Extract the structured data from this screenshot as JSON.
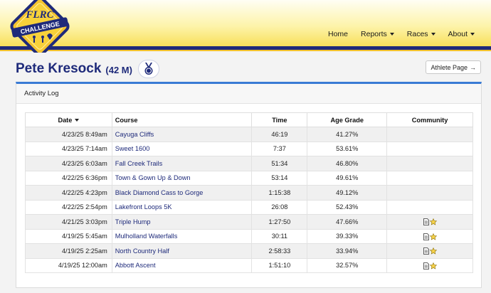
{
  "brand": {
    "logo_line1": "FLRC",
    "logo_line2": "CHALLENGE",
    "navy": "#1e2a7a",
    "yellow": "#f7dd52"
  },
  "nav": [
    {
      "label": "Home",
      "has_caret": false
    },
    {
      "label": "Reports",
      "has_caret": true
    },
    {
      "label": "Races",
      "has_caret": true
    },
    {
      "label": "About",
      "has_caret": true
    }
  ],
  "athlete": {
    "name": "Pete Kresock",
    "meta": "(42 M)",
    "page_button": "Athlete Page",
    "medal_icon": "medal-icon"
  },
  "card": {
    "title": "Activity Log"
  },
  "table": {
    "headers": {
      "date": "Date",
      "course": "Course",
      "time": "Time",
      "age_grade": "Age Grade",
      "community": "Community"
    },
    "rows": [
      {
        "date": "4/23/25 8:49am",
        "course": "Cayuga Cliffs",
        "time": "46:19",
        "age_grade": "41.27%",
        "community": false
      },
      {
        "date": "4/23/25 7:14am",
        "course": "Sweet 1600",
        "time": "7:37",
        "age_grade": "53.61%",
        "community": false
      },
      {
        "date": "4/23/25 6:03am",
        "course": "Fall Creek Trails",
        "time": "51:34",
        "age_grade": "46.80%",
        "community": false
      },
      {
        "date": "4/22/25 6:36pm",
        "course": "Town & Gown Up & Down",
        "time": "53:14",
        "age_grade": "49.61%",
        "community": false
      },
      {
        "date": "4/22/25 4:23pm",
        "course": "Black Diamond Cass to Gorge",
        "time": "1:15:38",
        "age_grade": "49.12%",
        "community": false
      },
      {
        "date": "4/22/25 2:54pm",
        "course": "Lakefront Loops 5K",
        "time": "26:08",
        "age_grade": "52.43%",
        "community": false
      },
      {
        "date": "4/21/25 3:03pm",
        "course": "Triple Hump",
        "time": "1:27:50",
        "age_grade": "47.66%",
        "community": true
      },
      {
        "date": "4/19/25 5:45am",
        "course": "Mulholland Waterfalls",
        "time": "30:11",
        "age_grade": "39.33%",
        "community": true
      },
      {
        "date": "4/19/25 2:25am",
        "course": "North Country Half",
        "time": "2:58:33",
        "age_grade": "33.94%",
        "community": true
      },
      {
        "date": "4/19/25 12:00am",
        "course": "Abbott Ascent",
        "time": "1:51:10",
        "age_grade": "32.57%",
        "community": true
      }
    ]
  }
}
